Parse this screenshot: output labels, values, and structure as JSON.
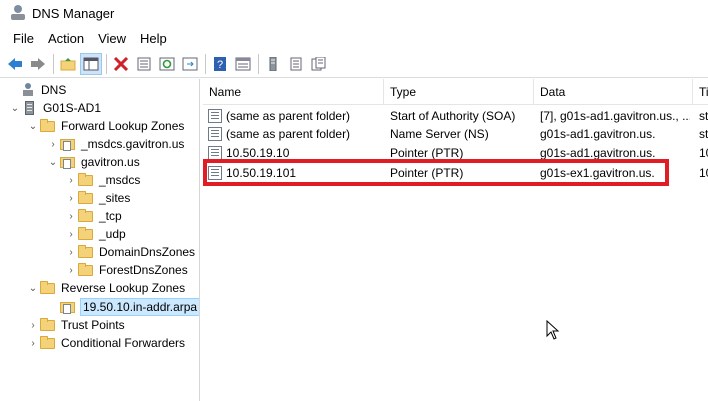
{
  "window": {
    "title": "DNS Manager"
  },
  "menu": [
    "File",
    "Action",
    "View",
    "Help"
  ],
  "toolbar": {
    "buttons": [
      "back-icon",
      "forward-icon",
      "up-folder-icon",
      "show-tree-icon",
      "delete-icon",
      "properties-icon",
      "refresh-icon",
      "export-icon",
      "help-icon",
      "console-icon",
      "server-icon",
      "record-icon",
      "record-list-icon"
    ]
  },
  "tree": {
    "root": "DNS",
    "server": "G01S-AD1",
    "forward_zones": "Forward Lookup Zones",
    "fwd_children": [
      "_msdcs.gavitron.us",
      "gavitron.us"
    ],
    "gavitron_children": [
      "_msdcs",
      "_sites",
      "_tcp",
      "_udp",
      "DomainDnsZones",
      "ForestDnsZones"
    ],
    "reverse_zones": "Reverse Lookup Zones",
    "reverse_child": "19.50.10.in-addr.arpa",
    "trust_points": "Trust Points",
    "conditional_forwarders": "Conditional Forwarders"
  },
  "list": {
    "columns": [
      "Name",
      "Type",
      "Data",
      "Ti"
    ],
    "rows": [
      {
        "name": "(same as parent folder)",
        "type": "Start of Authority (SOA)",
        "data": "[7], g01s-ad1.gavitron.us., ...",
        "ts": "st"
      },
      {
        "name": "(same as parent folder)",
        "type": "Name Server (NS)",
        "data": "g01s-ad1.gavitron.us.",
        "ts": "st"
      },
      {
        "name": "10.50.19.10",
        "type": "Pointer (PTR)",
        "data": "g01s-ad1.gavitron.us.",
        "ts": "10"
      },
      {
        "name": "10.50.19.101",
        "type": "Pointer (PTR)",
        "data": "g01s-ex1.gavitron.us.",
        "ts": "10"
      }
    ]
  },
  "colors": {
    "highlight": "#e01c24",
    "selection": "#cce8ff",
    "folder": "#f4d27a"
  }
}
